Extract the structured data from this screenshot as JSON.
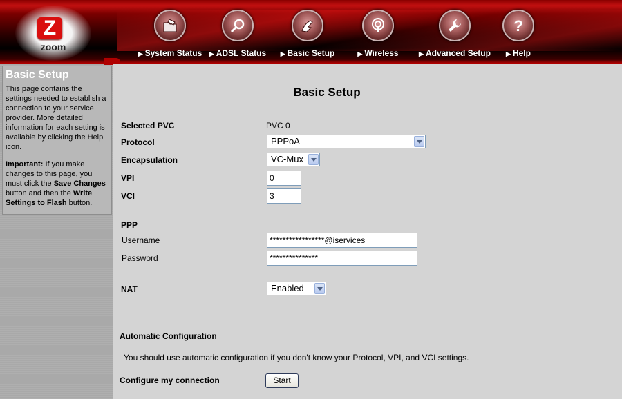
{
  "header": {
    "logo_letter": "Z",
    "logo_text": "zoom",
    "nav": [
      {
        "label": "System Status",
        "icon": "folder-icon"
      },
      {
        "label": "ADSL Status",
        "icon": "magnifier-icon"
      },
      {
        "label": "Basic Setup",
        "icon": "hand-icon"
      },
      {
        "label": "Wireless",
        "icon": "antenna-icon"
      },
      {
        "label": "Advanced Setup",
        "icon": "wrench-icon"
      },
      {
        "label": "Help",
        "icon": "question-icon"
      }
    ]
  },
  "sidebar": {
    "title": "Basic Setup",
    "intro": "This page contains the settings needed to establish a connection to your service provider. More detailed information for each setting is available by clicking the Help icon.",
    "important_label": "Important:",
    "important_text_1": " If you make changes to this page, you must click the ",
    "save_changes": "Save Changes",
    "important_text_2": " button and then the ",
    "write_flash": "Write Settings to Flash",
    "important_text_3": " button."
  },
  "main": {
    "title": "Basic Setup",
    "selected_pvc_label": "Selected PVC",
    "selected_pvc_value": "PVC 0",
    "protocol_label": "Protocol",
    "protocol_value": "PPPoA",
    "encapsulation_label": "Encapsulation",
    "encapsulation_value": "VC-Mux",
    "vpi_label": "VPI",
    "vpi_value": "0",
    "vci_label": "VCI",
    "vci_value": "3",
    "ppp_heading": "PPP",
    "username_label": "Username",
    "username_value": "*****************@iservices",
    "password_label": "Password",
    "password_value": "***************",
    "nat_label": "NAT",
    "nat_value": "Enabled",
    "auto_config_heading": "Automatic Configuration",
    "auto_config_text": "You should use automatic configuration if you don't know your Protocol, VPI, and VCI settings.",
    "configure_label": "Configure my connection",
    "start_button": "Start"
  },
  "colors": {
    "header_red": "#c21010",
    "divider": "#a02020",
    "sidebar_bg": "#a9a9a9",
    "main_bg": "#d4d4d4"
  }
}
